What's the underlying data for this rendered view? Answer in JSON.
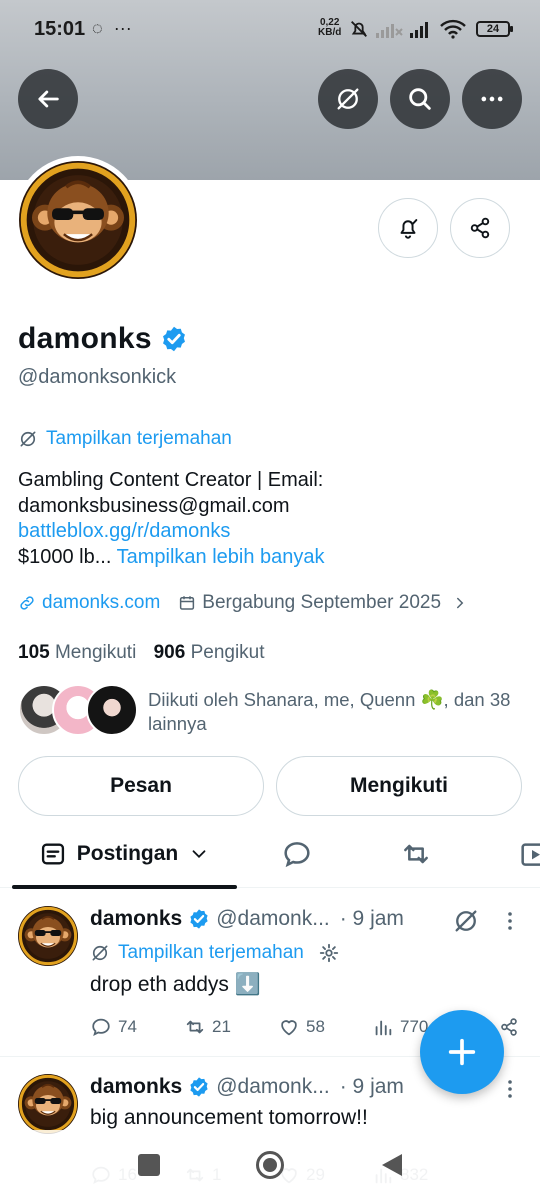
{
  "status_bar": {
    "time": "15:01",
    "net_speed_value": "0,22",
    "net_speed_unit": "KB/d",
    "battery": "24"
  },
  "profile": {
    "display_name": "damonks",
    "handle": "@damonksonkick",
    "verified": true,
    "translate_label": "Tampilkan terjemahan",
    "bio_line1": "Gambling Content Creator | Email:",
    "bio_line2": "damonksbusiness@gmail.com",
    "bio_link": "battleblox.gg/r/damonks",
    "bio_truncated": "$1000 lb...",
    "show_more": "Tampilkan lebih banyak",
    "website": "damonks.com",
    "joined": "Bergabung September 2025",
    "following_count": "105",
    "following_label": "Mengikuti",
    "followers_count": "906",
    "followers_label": "Pengikut",
    "followed_by": "Diikuti oleh Shanara, me, Quenn ☘️, dan 38 lainnya"
  },
  "actions": {
    "message_label": "Pesan",
    "following_button_label": "Mengikuti"
  },
  "tabs": {
    "active_label": "Postingan"
  },
  "tweets": [
    {
      "name": "damonks",
      "handle": "@damonk...",
      "time": "· 9 jam",
      "translate_label": "Tampilkan terjemahan",
      "text": "drop eth addys ⬇️",
      "replies": "74",
      "retweets": "21",
      "likes": "58",
      "views": "770"
    },
    {
      "name": "damonks",
      "handle": "@damonk...",
      "time": "· 9 jam",
      "text": "big announcement tomorrow!!",
      "replies": "16",
      "retweets": "1",
      "likes": "29",
      "views": "832"
    }
  ],
  "colors": {
    "accent": "#1d9bf0",
    "text_primary": "#0f1419",
    "text_secondary": "#536471",
    "border": "#cfd9de"
  },
  "icons": [
    "back-arrow-icon",
    "translate-icon",
    "search-icon",
    "more-icon",
    "bell-check-icon",
    "share-icon",
    "link-icon",
    "calendar-icon",
    "chevron-right-icon",
    "verified-badge-icon",
    "reply-icon",
    "retweet-icon",
    "like-icon",
    "views-icon",
    "plus-icon",
    "gear-icon"
  ]
}
